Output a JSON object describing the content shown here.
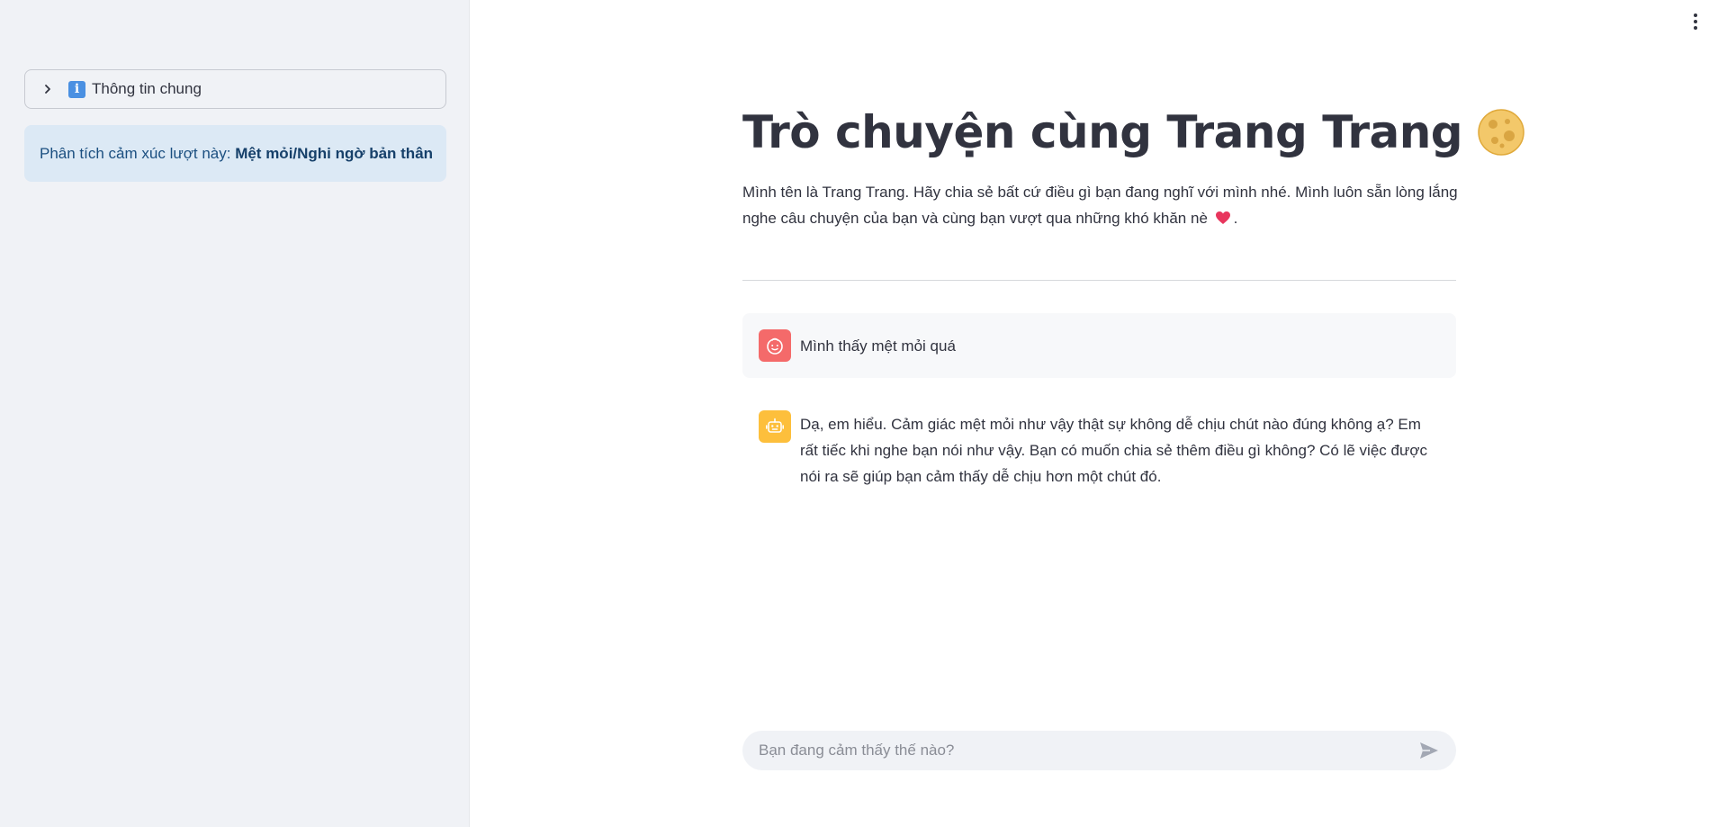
{
  "sidebar": {
    "expander_label": "Thông tin chung",
    "emotion_prefix": "Phân tích cảm xúc lượt này: ",
    "emotion_value": "Mệt mỏi/Nghi ngờ bản thân"
  },
  "main": {
    "title": "Trò chuyện cùng Trang Trang",
    "intro_line1": "Mình tên là Trang Trang. Hãy chia sẻ bất cứ điều gì bạn đang nghĩ với mình nhé. Mình luôn sẵn lòng lắng",
    "intro_line2": "nghe câu chuyện của bạn và cùng bạn vượt qua những khó khăn nè",
    "intro_end": "."
  },
  "messages": [
    {
      "role": "user",
      "text": "Mình thấy mệt mỏi quá"
    },
    {
      "role": "assistant",
      "text": "Dạ, em hiểu. Cảm giác mệt mỏi như vậy thật sự không dễ chịu chút nào đúng không ạ? Em rất tiếc khi nghe bạn nói như vậy. Bạn có muốn chia sẻ thêm điều gì không? Có lẽ việc được nói ra sẽ giúp bạn cảm thấy dễ chịu hơn một chút đó."
    }
  ],
  "chat_input": {
    "placeholder": "Bạn đang cảm thấy thế nào?"
  },
  "icons": {
    "title_emoji": "moon-icon",
    "intro_emoji": "heart-icon",
    "user_avatar": "user-face-icon",
    "bot_avatar": "robot-icon"
  },
  "colors": {
    "sidebar_bg": "#f0f2f6",
    "info_box_bg": "#dce9f5",
    "user_avatar": "#f46a6a",
    "bot_avatar": "#fdbf3c",
    "text": "#31333f"
  }
}
